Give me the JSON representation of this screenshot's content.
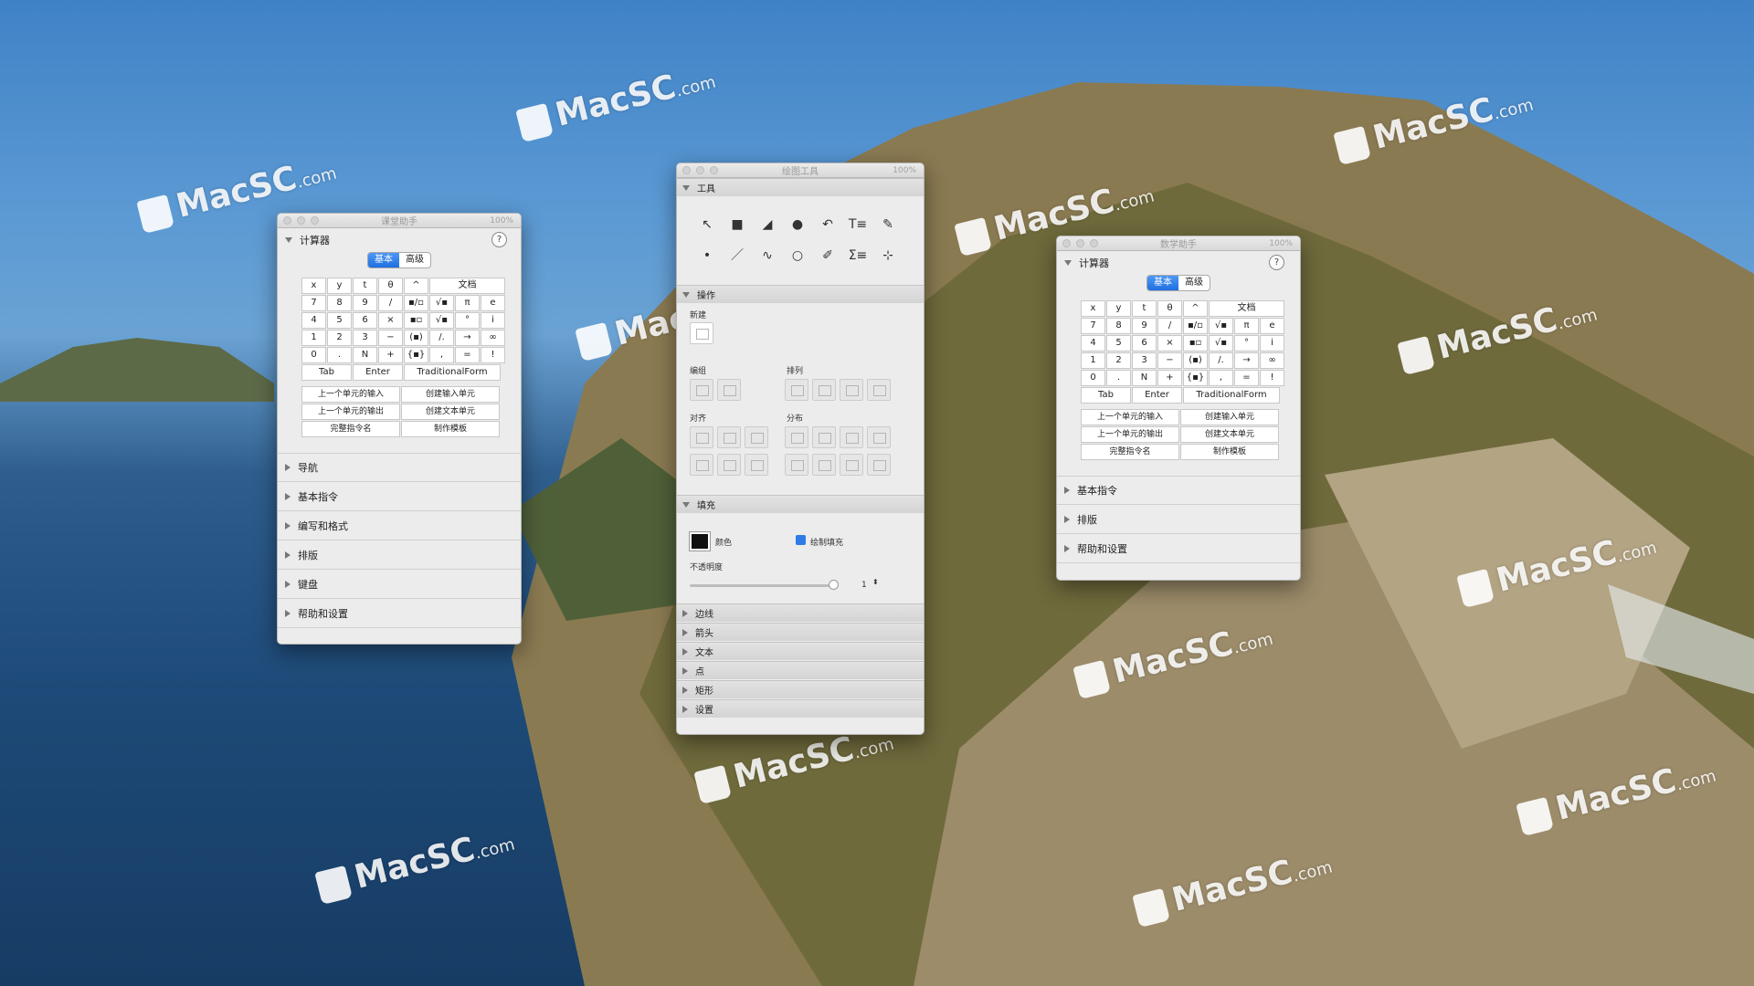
{
  "watermark": {
    "brand": "MacSC",
    "suffix": ".com"
  },
  "classroom_window": {
    "title": "课堂助手",
    "zoom": "100%",
    "calculator": {
      "header": "计算器",
      "tabs": [
        "基本",
        "高级"
      ],
      "help": "?",
      "keys": [
        "x",
        "y",
        "t",
        "θ",
        "^",
        "文档",
        "7",
        "8",
        "9",
        "/",
        "▪/▫",
        "√▪",
        "π",
        "e",
        "4",
        "5",
        "6",
        "×",
        "▪▫",
        "√▪",
        "°",
        "i",
        "1",
        "2",
        "3",
        "−",
        "(▪)",
        "/.",
        "→",
        "∞",
        "0",
        ".",
        "N",
        "+",
        "{▪}",
        ",",
        "=",
        "!"
      ],
      "bottom": [
        "Tab",
        "Enter",
        "TraditionalForm"
      ],
      "actions": [
        "上一个单元的输入",
        "创建输入单元",
        "上一个单元的输出",
        "创建文本单元",
        "完整指令名",
        "制作模板"
      ]
    },
    "sections": [
      "导航",
      "基本指令",
      "编写和格式",
      "排版",
      "键盘",
      "帮助和设置"
    ]
  },
  "draw_window": {
    "title": "绘图工具",
    "zoom": "100%",
    "tools_header": "工具",
    "tools_row1": [
      "↖",
      "■",
      "◢",
      "●",
      "↶",
      "T≡",
      "✎"
    ],
    "tools_row2": [
      "•",
      "／",
      "∿",
      "○",
      "✐",
      "Σ≡",
      "⊹"
    ],
    "ops_header": "操作",
    "ops": {
      "new": "新建",
      "group": "编组",
      "arrange": "排列",
      "align": "对齐",
      "distribute": "分布"
    },
    "fill_header": "填充",
    "fill": {
      "color_label": "颜色",
      "draw_fill": "绘制填充",
      "opacity": "不透明度",
      "value": "1"
    },
    "sections": [
      "边线",
      "箭头",
      "文本",
      "点",
      "矩形",
      "设置"
    ]
  },
  "math_window": {
    "title": "数学助手",
    "zoom": "100%",
    "calculator": {
      "header": "计算器",
      "tabs": [
        "基本",
        "高级"
      ],
      "help": "?",
      "keys": [
        "x",
        "y",
        "t",
        "θ",
        "^",
        "文档",
        "7",
        "8",
        "9",
        "/",
        "▪/▫",
        "√▪",
        "π",
        "e",
        "4",
        "5",
        "6",
        "×",
        "▪▫",
        "√▪",
        "°",
        "i",
        "1",
        "2",
        "3",
        "−",
        "(▪)",
        "/.",
        "→",
        "∞",
        "0",
        ".",
        "N",
        "+",
        "{▪}",
        ",",
        "=",
        "!"
      ],
      "bottom": [
        "Tab",
        "Enter",
        "TraditionalForm"
      ],
      "actions": [
        "上一个单元的输入",
        "创建输入单元",
        "上一个单元的输出",
        "创建文本单元",
        "完整指令名",
        "制作模板"
      ]
    },
    "sections": [
      "基本指令",
      "排版",
      "帮助和设置"
    ]
  }
}
